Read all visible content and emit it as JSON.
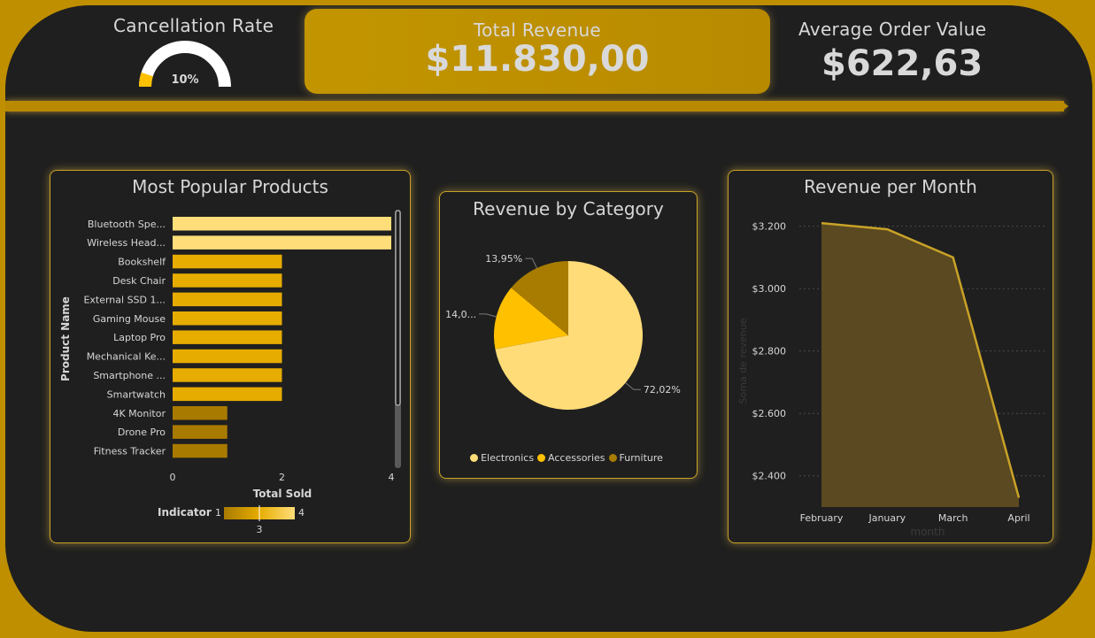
{
  "kpis": {
    "cancellation_title": "Cancellation Rate",
    "cancellation_value": "10%",
    "cancellation_fraction": 0.1,
    "revenue_title": "Total Revenue",
    "revenue_value": "$11.830,00",
    "aov_title": "Average Order Value",
    "aov_value": "$622,63"
  },
  "colors": {
    "accent": "#bf8f00",
    "background": "#1f1f1f",
    "bar_high": "#ffde7a",
    "bar_mid": "#e6ac00",
    "bar_low": "#a97a00",
    "pie_electronics": "#ffdc78",
    "pie_accessories": "#ffc000",
    "pie_furniture": "#a87c00",
    "area_fill": "#5e4c22",
    "area_line": "#c9a227"
  },
  "chart_data": [
    {
      "type": "bar",
      "title": "Most Popular Products",
      "xlabel": "Total Sold",
      "ylabel": "Product Name",
      "categories": [
        "Bluetooth Spe...",
        "Wireless Head...",
        "Bookshelf",
        "Desk Chair",
        "External SSD 1...",
        "Gaming Mouse",
        "Laptop Pro",
        "Mechanical Ke...",
        "Smartphone ...",
        "Smartwatch",
        "4K Monitor",
        "Drone Pro",
        "Fitness Tracker"
      ],
      "values": [
        4,
        4,
        2,
        2,
        2,
        2,
        2,
        2,
        2,
        2,
        1,
        1,
        1
      ],
      "xlim": [
        0,
        4
      ],
      "xticks": [
        "0",
        "2",
        "4"
      ],
      "legend": {
        "title": "Indicator",
        "min": "1",
        "max": "4",
        "mid": "3"
      }
    },
    {
      "type": "pie",
      "title": "Revenue by Category",
      "categories": [
        "Electronics",
        "Accessories",
        "Furniture"
      ],
      "values": [
        72.02,
        14.03,
        13.95
      ],
      "labels": [
        "72,02%",
        "14,0...",
        "13,95%"
      ],
      "legend_position": "bottom"
    },
    {
      "type": "area",
      "title": "Revenue per Month",
      "xlabel": "month",
      "ylabel": "Soma de revenue",
      "categories": [
        "February",
        "January",
        "March",
        "April"
      ],
      "values": [
        3210,
        3190,
        3100,
        2330
      ],
      "ylim": [
        2300,
        3250
      ],
      "yticks": [
        2400,
        2600,
        2800,
        3000,
        3200
      ],
      "ytick_labels": [
        "$2.400",
        "$2.600",
        "$2.800",
        "$3.000",
        "$3.200"
      ],
      "grid": true
    }
  ]
}
